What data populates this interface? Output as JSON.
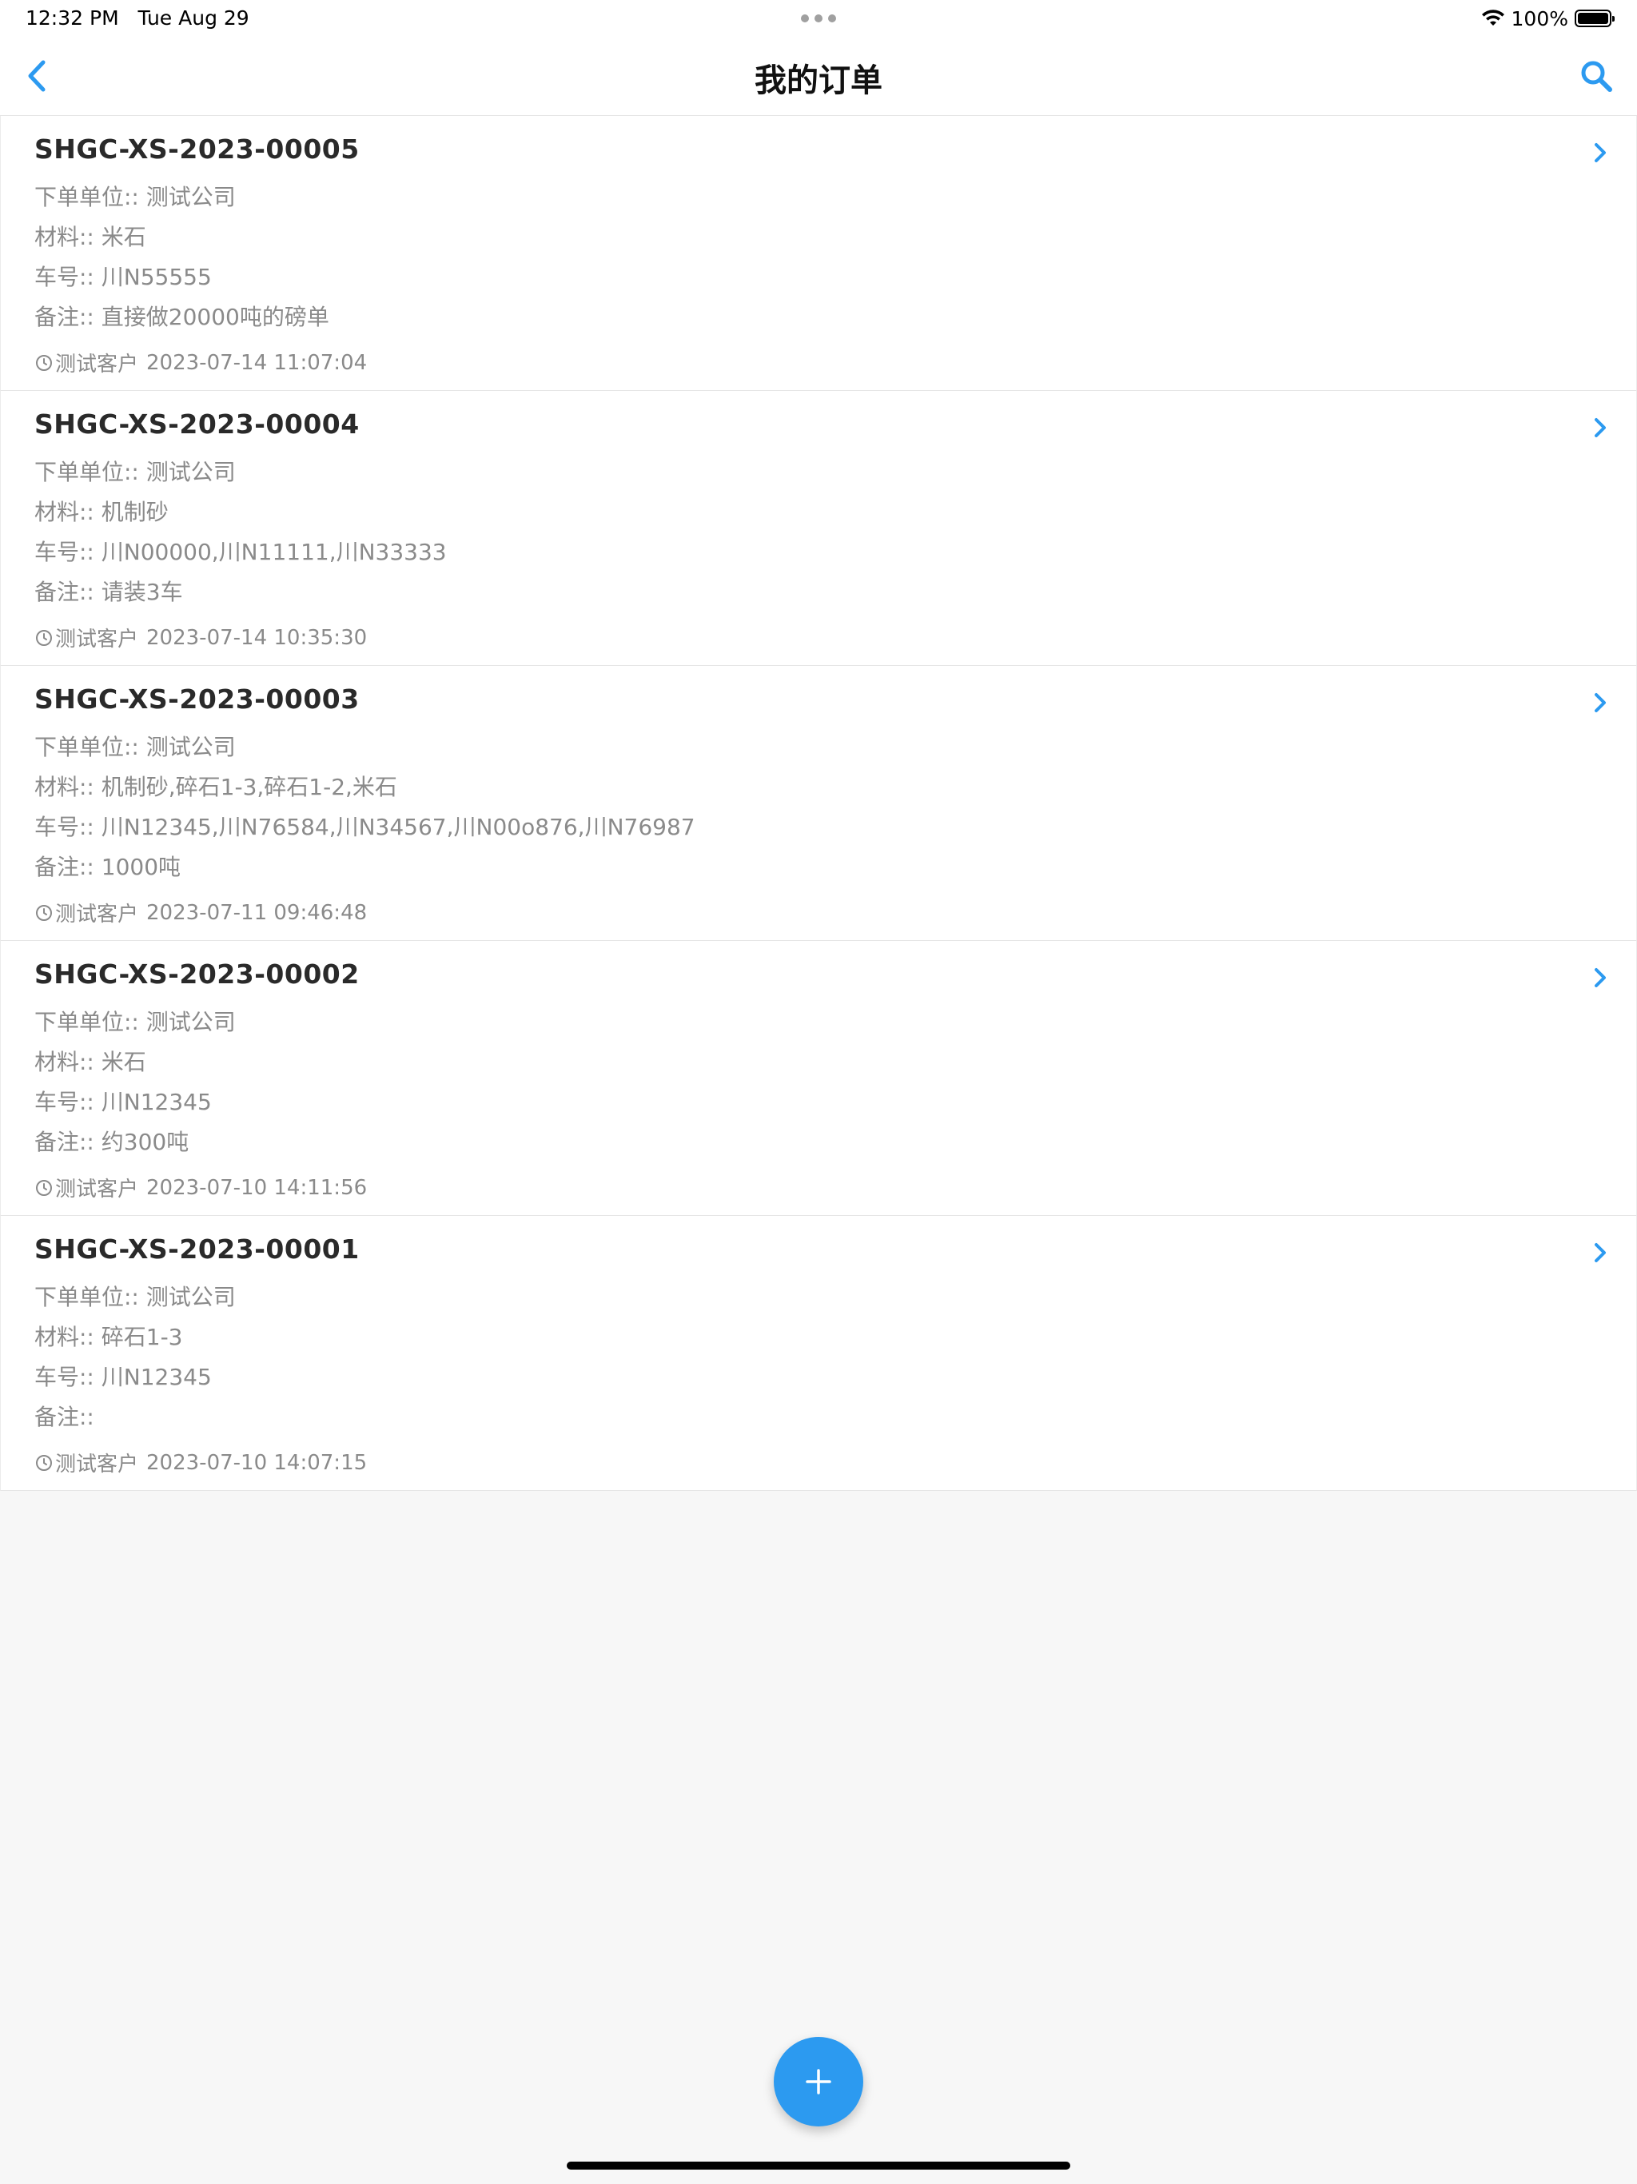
{
  "status_bar": {
    "time": "12:32 PM",
    "date": "Tue Aug 29",
    "battery_percent": "100%",
    "battery_level": 1.0
  },
  "nav": {
    "title": "我的订单",
    "back_icon": "chevron-left-icon",
    "search_icon": "search-icon"
  },
  "accent_color": "#2c9af0",
  "orders": [
    {
      "id": "SHGC-XS-2023-00005",
      "company_line": "下单单位:: 测试公司",
      "material_line": "材料:: 米石",
      "vehicle_line": "车号:: 川N55555",
      "remark_line": "备注:: 直接做20000吨的磅单",
      "customer": "测试客户",
      "time": "2023-07-14 11:07:04"
    },
    {
      "id": "SHGC-XS-2023-00004",
      "company_line": "下单单位:: 测试公司",
      "material_line": "材料:: 机制砂",
      "vehicle_line": "车号:: 川N00000,川N11111,川N33333",
      "remark_line": "备注:: 请装3车",
      "customer": "测试客户",
      "time": "2023-07-14 10:35:30"
    },
    {
      "id": "SHGC-XS-2023-00003",
      "company_line": "下单单位:: 测试公司",
      "material_line": "材料:: 机制砂,碎石1-3,碎石1-2,米石",
      "vehicle_line": "车号:: 川N12345,川N76584,川N34567,川N00o876,川N76987",
      "remark_line": "备注:: 1000吨",
      "customer": "测试客户",
      "time": "2023-07-11 09:46:48"
    },
    {
      "id": "SHGC-XS-2023-00002",
      "company_line": "下单单位:: 测试公司",
      "material_line": "材料:: 米石",
      "vehicle_line": "车号:: 川N12345",
      "remark_line": "备注:: 约300吨",
      "customer": "测试客户",
      "time": "2023-07-10 14:11:56"
    },
    {
      "id": "SHGC-XS-2023-00001",
      "company_line": "下单单位:: 测试公司",
      "material_line": "材料:: 碎石1-3",
      "vehicle_line": "车号:: 川N12345",
      "remark_line": "备注::",
      "customer": "测试客户",
      "time": "2023-07-10 14:07:15"
    }
  ],
  "fab_icon": "plus-icon"
}
